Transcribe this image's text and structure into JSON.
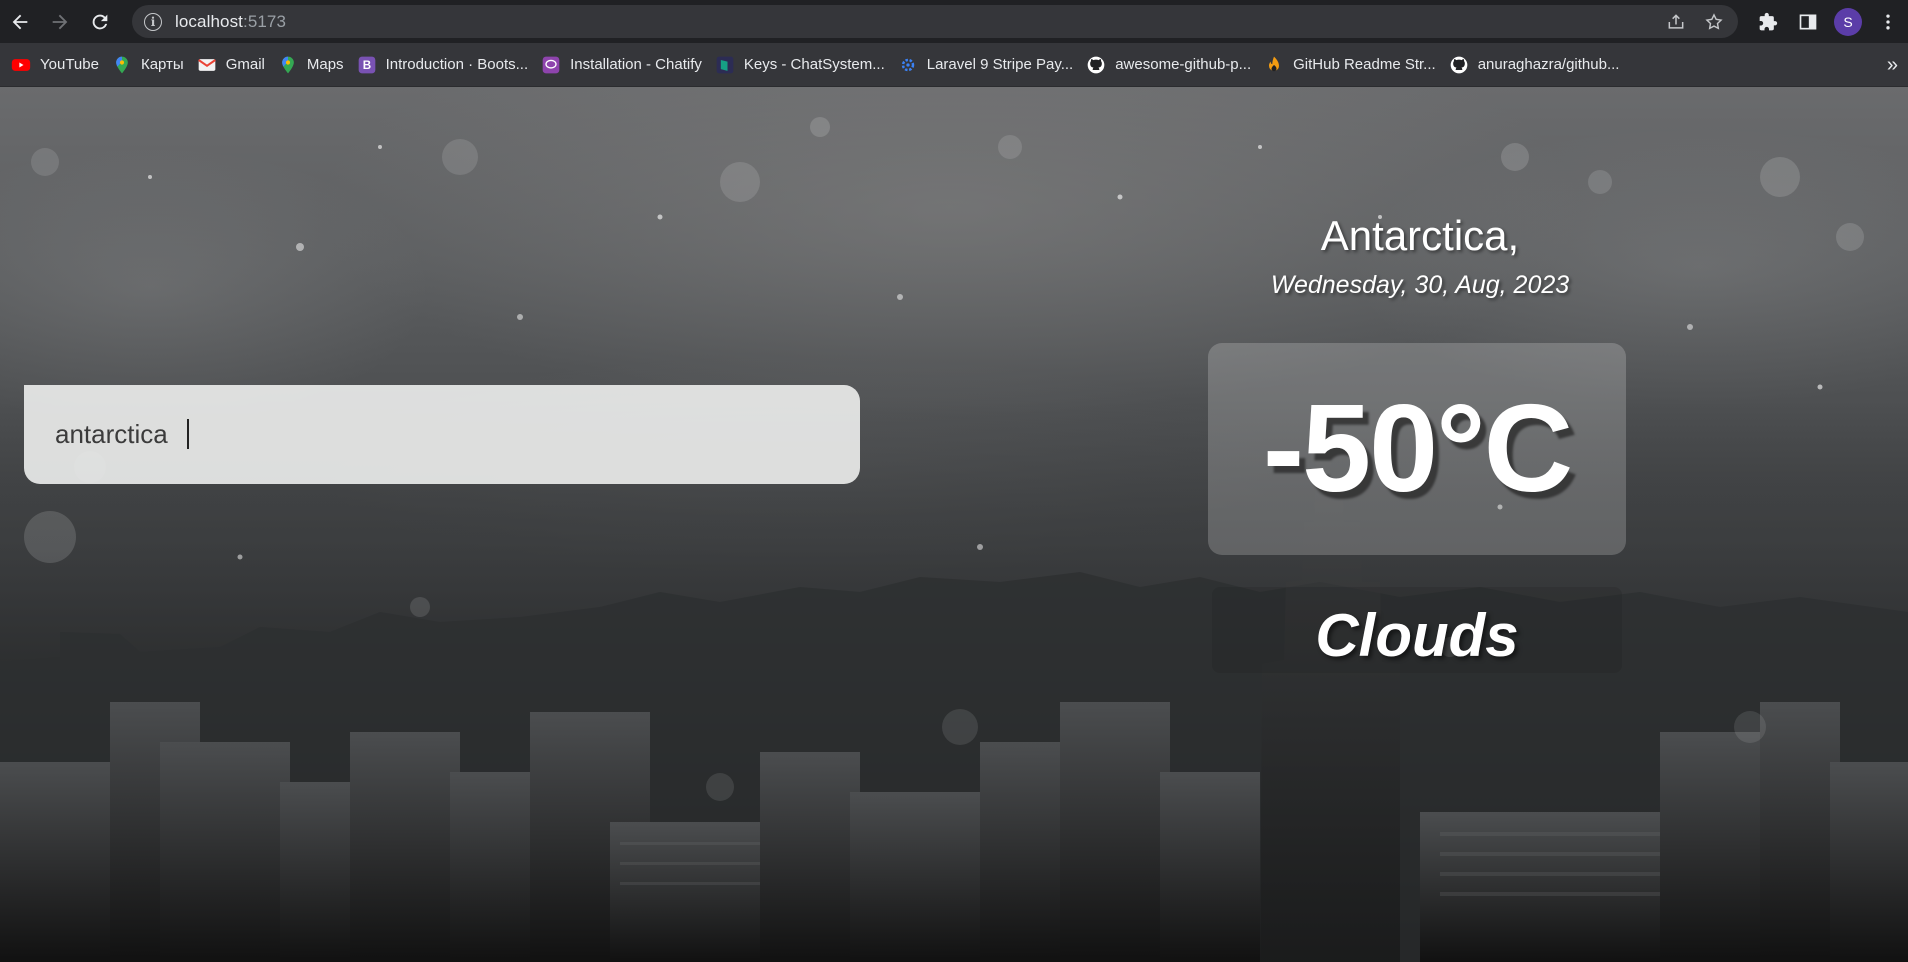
{
  "browser": {
    "url_host": "localhost",
    "url_port": ":5173",
    "profile_initial": "S",
    "bookmarks": [
      {
        "label": "YouTube",
        "icon": "youtube-icon",
        "color": "#ff0000"
      },
      {
        "label": "Карты",
        "icon": "maps-pin-icon",
        "color": "#34a853"
      },
      {
        "label": "Gmail",
        "icon": "gmail-icon",
        "color": "#ea4335"
      },
      {
        "label": "Maps",
        "icon": "maps-pin-icon",
        "color": "#34a853"
      },
      {
        "label": "Introduction · Boots...",
        "icon": "bootstrap-icon",
        "color": "#7952b3"
      },
      {
        "label": "Installation - Chatify",
        "icon": "chat-icon",
        "color": "#9b59b6"
      },
      {
        "label": "Keys - ChatSystem...",
        "icon": "keys-icon",
        "color": "#1abc9c"
      },
      {
        "label": "Laravel 9 Stripe Pay...",
        "icon": "gear-icon",
        "color": "#3b82f6"
      },
      {
        "label": "awesome-github-p...",
        "icon": "github-icon",
        "color": "#ffffff"
      },
      {
        "label": "GitHub Readme Str...",
        "icon": "flame-icon",
        "color": "#f39c12"
      },
      {
        "label": "anuraghazra/github...",
        "icon": "github-icon",
        "color": "#ffffff"
      }
    ],
    "more_label": "»"
  },
  "search": {
    "value": "antarctica"
  },
  "weather": {
    "location": "Antarctica,",
    "date": "Wednesday, 30, Aug, 2023",
    "temperature": "-50°C",
    "condition": "Clouds"
  }
}
